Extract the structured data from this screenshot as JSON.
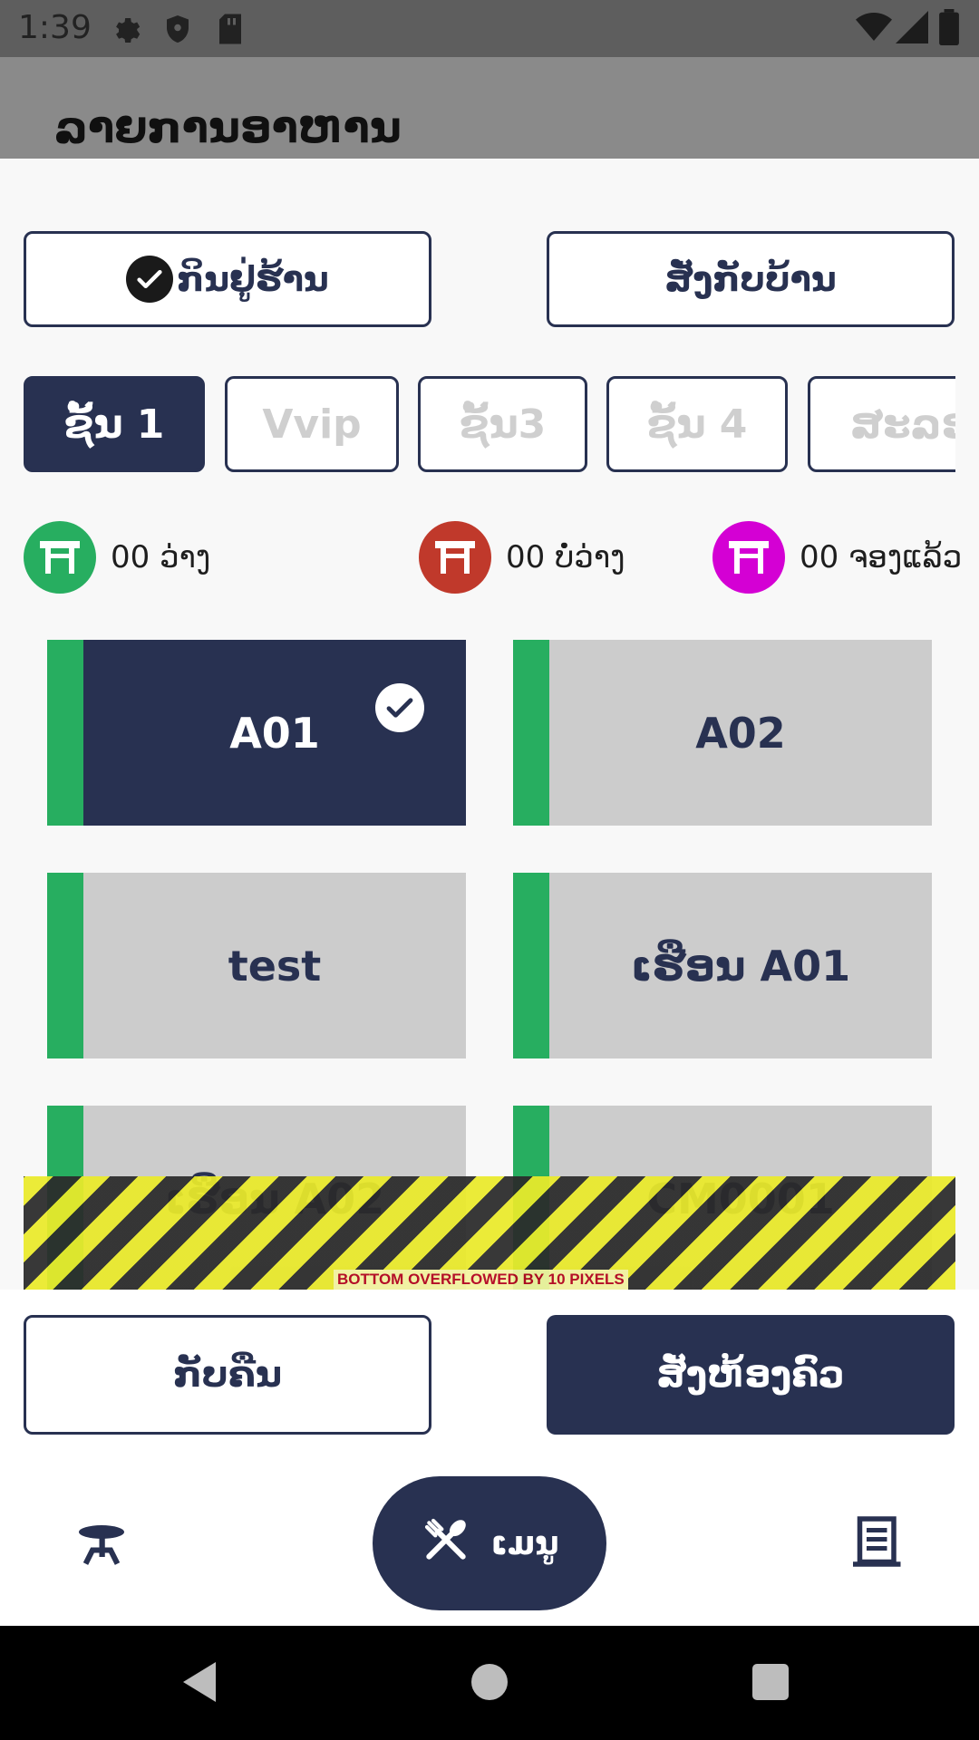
{
  "status_bar": {
    "time": "1:39"
  },
  "background_page": {
    "title": "ລາຍການອາຫານ"
  },
  "service_mode": {
    "dine_in": {
      "label": "ກິນຢູ່ຮ້ານ",
      "selected": true
    },
    "takeaway": {
      "label": "ສັ່ງກັບບ້ານ",
      "selected": false
    }
  },
  "floors": [
    {
      "label": "ຊັ້ນ 1",
      "active": true
    },
    {
      "label": "Vvip",
      "active": false
    },
    {
      "label": "ຊັ້ນ3",
      "active": false
    },
    {
      "label": "ຊັ້ນ 4",
      "active": false
    },
    {
      "label": "ສະລອ",
      "active": false
    }
  ],
  "legend": {
    "free": {
      "text": "00 ວ່າງ",
      "color": "#27ae60"
    },
    "busy": {
      "text": "00 ບໍ່ວ່າງ",
      "color": "#c0392b"
    },
    "reserved": {
      "text": "00 ຈອງແລ້ວ",
      "color": "#d400d4"
    }
  },
  "tables": [
    {
      "name": "A01",
      "selected": true
    },
    {
      "name": "A02",
      "selected": false
    },
    {
      "name": "test",
      "selected": false
    },
    {
      "name": "ເຮືອນ A01",
      "selected": false
    },
    {
      "name": "ເຮືອນ A02",
      "selected": false
    },
    {
      "name": "CM0001",
      "selected": false
    }
  ],
  "overflow_warning": "BOTTOM OVERFLOWED BY 10 PIXELS",
  "actions": {
    "back_label": "ກັບຄືນ",
    "order_label": "ສັ່ງຫ້ອງຄົວ"
  },
  "bottom_nav": {
    "menu_label": "ເມນູ"
  },
  "colors": {
    "primary": "#283151",
    "free": "#27ae60",
    "busy": "#c0392b",
    "reserved": "#d400d4",
    "card": "#cccccc"
  },
  "icons": [
    "gear-icon",
    "shield-icon",
    "sd-card-icon",
    "wifi-icon",
    "signal-icon",
    "battery-icon",
    "check-icon",
    "table-icon",
    "fork-knife-icon",
    "receipt-list-icon"
  ]
}
